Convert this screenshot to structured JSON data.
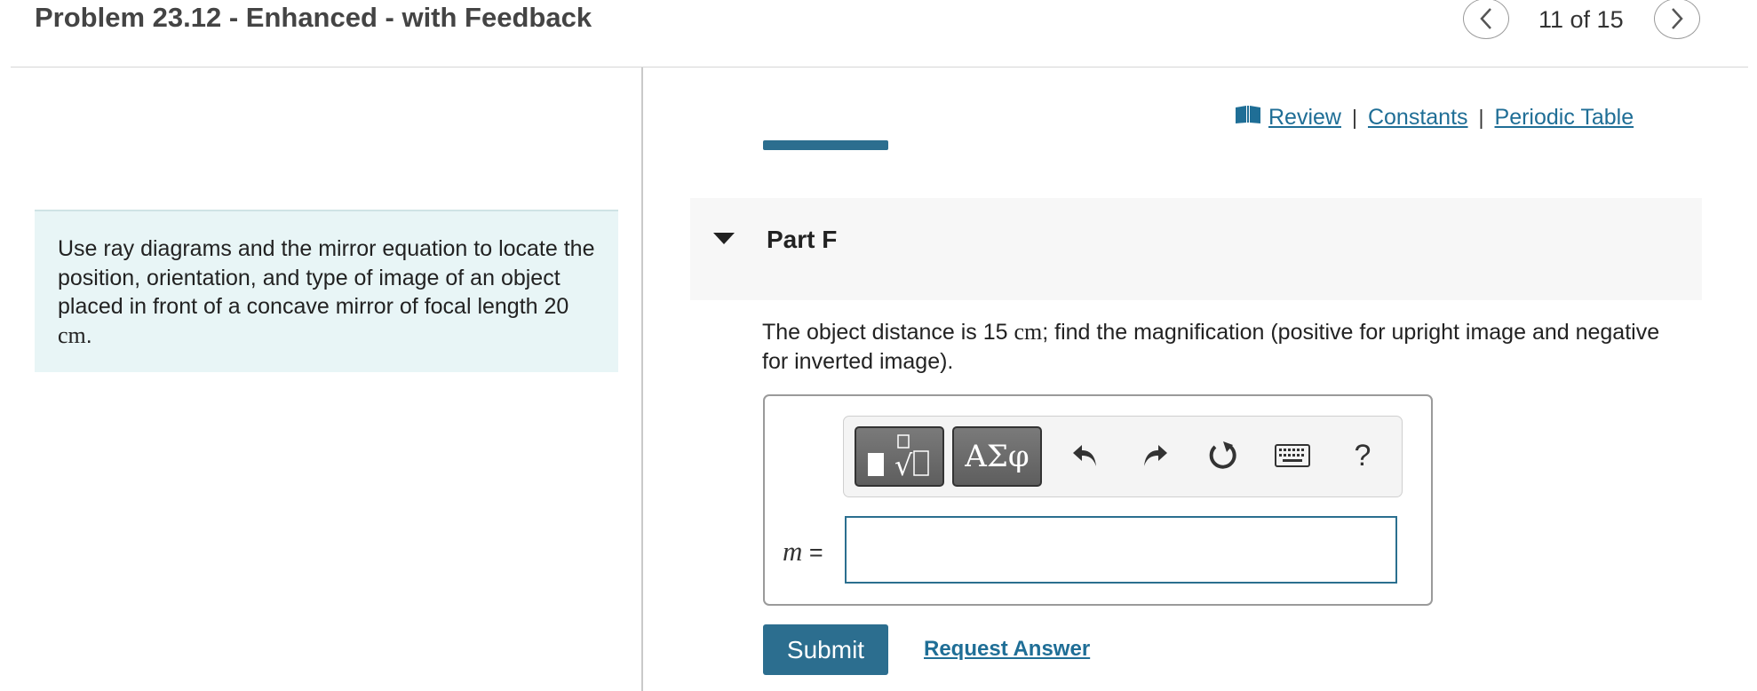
{
  "header": {
    "title": "Problem 23.12 - Enhanced - with Feedback",
    "pagination": "11 of 15",
    "prev_icon": "chevron-left-icon",
    "next_icon": "chevron-right-icon"
  },
  "intro": {
    "text_before": "Use ray diagrams and the mirror equation to locate the position, orientation, and type of image of an object placed in front of a concave mirror of focal length 20 ",
    "unit": "cm",
    "text_after": "."
  },
  "links": {
    "book_icon": "book-icon",
    "review": "Review",
    "separator": "|",
    "constants": "Constants",
    "periodic_table": "Periodic Table"
  },
  "part": {
    "label": "Part F",
    "caret_icon": "caret-down-icon"
  },
  "question": {
    "text_before": "The object distance is 15 ",
    "unit": "cm",
    "text_after": "; find the magnification (positive for upright image and negative for inverted image)."
  },
  "toolbar": {
    "template_icon": "fraction-root-template-icon",
    "greek_label": "ΑΣφ",
    "undo_icon": "undo-icon",
    "redo_icon": "redo-icon",
    "reset_icon": "reset-icon",
    "keyboard_icon": "keyboard-icon",
    "help_label": "?"
  },
  "answer": {
    "variable": "m",
    "equals": "=",
    "value": ""
  },
  "actions": {
    "submit": "Submit",
    "request_answer": "Request Answer"
  },
  "colors": {
    "accent": "#2c6e8f",
    "link": "#1f6e96",
    "intro_bg": "#e8f5f6",
    "part_bg": "#f7f7f7"
  }
}
